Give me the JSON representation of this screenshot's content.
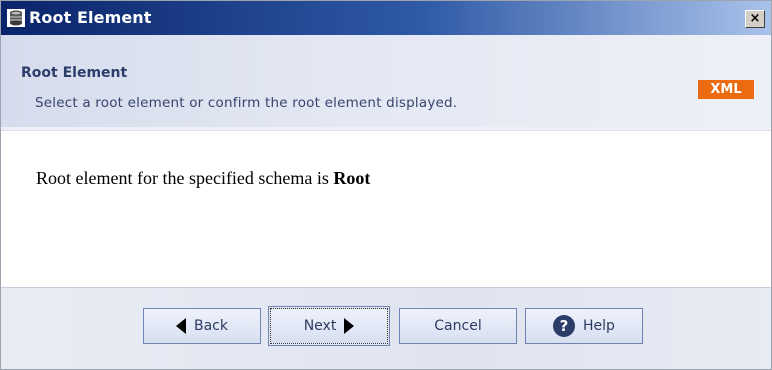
{
  "window": {
    "title": "Root Element",
    "close_glyph": "×"
  },
  "header": {
    "title": "Root Element",
    "subtitle": "Select a root element or confirm the root element displayed.",
    "badge": "XML"
  },
  "content": {
    "message": "Root element for the specified schema is",
    "root_name": "Root"
  },
  "buttons": {
    "back": "Back",
    "next": "Next",
    "cancel": "Cancel",
    "help": "Help",
    "help_glyph": "?"
  },
  "icons": {
    "app": "database-icon",
    "back": "arrow-left-icon",
    "next": "arrow-right-icon",
    "help": "help-circle-icon",
    "close": "close-icon"
  },
  "colors": {
    "titlebar_start": "#0a246a",
    "badge": "#ec6a10",
    "header_text": "#2c3d6a"
  }
}
